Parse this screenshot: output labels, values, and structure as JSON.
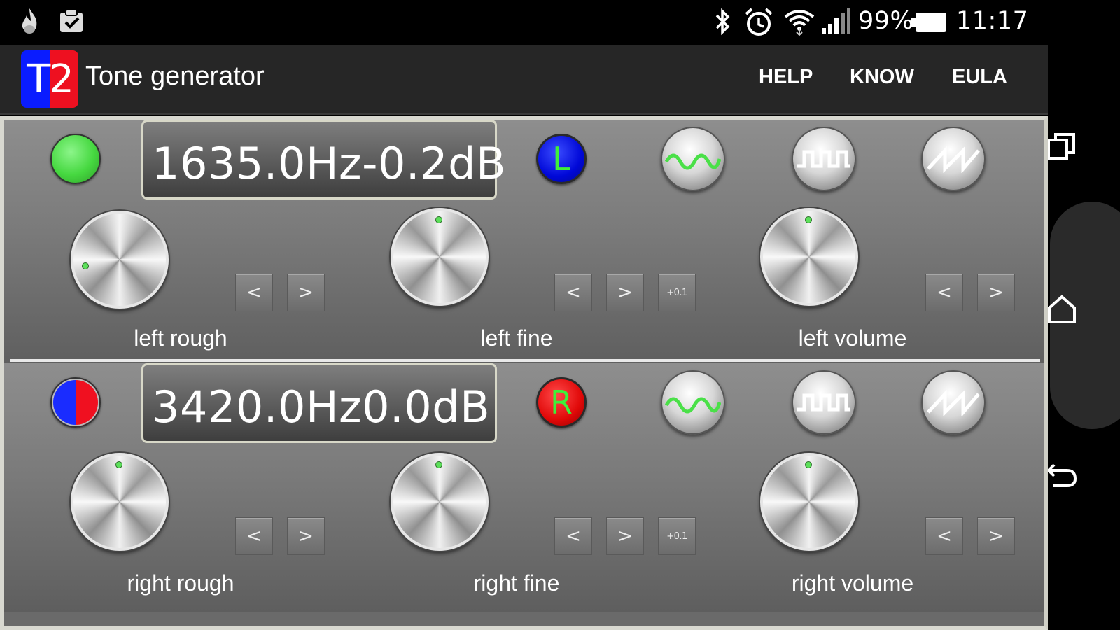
{
  "status_bar": {
    "battery": "99%",
    "time": "11:17",
    "left_icons": [
      "flame-icon",
      "clipboard-check-icon"
    ],
    "right_icons": [
      "bluetooth-icon",
      "alarm-clock-icon",
      "wifi-icon",
      "signal-icon",
      "battery-icon"
    ]
  },
  "app": {
    "logo_text": "T2",
    "title": "Tone generator",
    "menu": [
      "HELP",
      "KNOW",
      "EULA"
    ]
  },
  "left": {
    "display_freq": "1635.0Hz",
    "display_db": "-0.2dB",
    "channel_letter": "L",
    "knobs": {
      "rough_label": "left rough",
      "fine_label": "left fine",
      "volume_label": "left volume"
    }
  },
  "right": {
    "display_freq": "3420.0Hz",
    "display_db": "0.0dB",
    "channel_letter": "R",
    "knobs": {
      "rough_label": "right rough",
      "fine_label": "right fine",
      "volume_label": "right volume"
    }
  },
  "buttons": {
    "prev": "<",
    "next": ">",
    "fine_step": "+0.1"
  },
  "colors": {
    "accent_green": "#3ef03a",
    "left_channel": "#0008d8",
    "right_channel": "#e00808",
    "panel_bg": "#6a6a6a"
  }
}
